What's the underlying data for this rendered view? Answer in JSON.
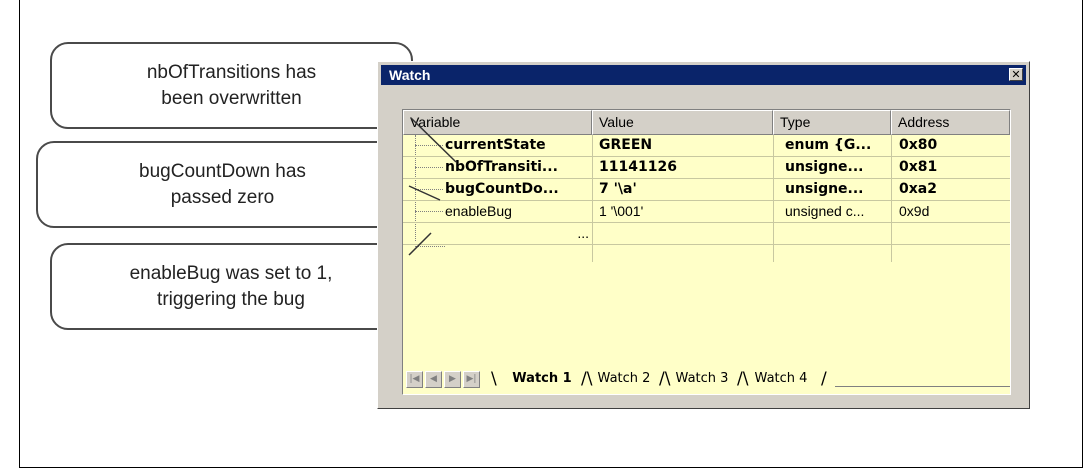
{
  "callouts": [
    {
      "text": "nbOfTransitions has\nbeen overwritten"
    },
    {
      "text": "bugCountDown has\npassed zero"
    },
    {
      "text": "enableBug was set to 1,\ntriggering the bug"
    }
  ],
  "watch_window": {
    "title": "Watch",
    "close_icon": "✕",
    "columns": [
      "Variable",
      "Value",
      "Type",
      "Address"
    ],
    "rows": [
      {
        "variable": "currentState",
        "value": "GREEN",
        "type": "enum {G...",
        "address": "0x80",
        "bold": true
      },
      {
        "variable": "nbOfTransiti...",
        "value": "11141126",
        "type": "unsigne...",
        "address": "0x81",
        "bold": true
      },
      {
        "variable": "bugCountDo...",
        "value": "7 '\\a'",
        "type": "unsigne...",
        "address": "0xa2",
        "bold": true
      },
      {
        "variable": "enableBug",
        "value": "1 '\\001'",
        "type": "unsigned c...",
        "address": "0x9d",
        "bold": false
      },
      {
        "variable": "...",
        "value": "",
        "type": "",
        "address": "",
        "bold": false
      }
    ],
    "tabs": [
      "Watch 1",
      "Watch 2",
      "Watch 3",
      "Watch 4"
    ],
    "active_tab": "Watch 1",
    "nav_icons": [
      "first-icon",
      "prev-icon",
      "next-icon",
      "last-icon"
    ],
    "colors": {
      "title_bar": "#0a246a",
      "panel_bg": "#ffffc8",
      "chrome": "#d4d0c8"
    }
  }
}
